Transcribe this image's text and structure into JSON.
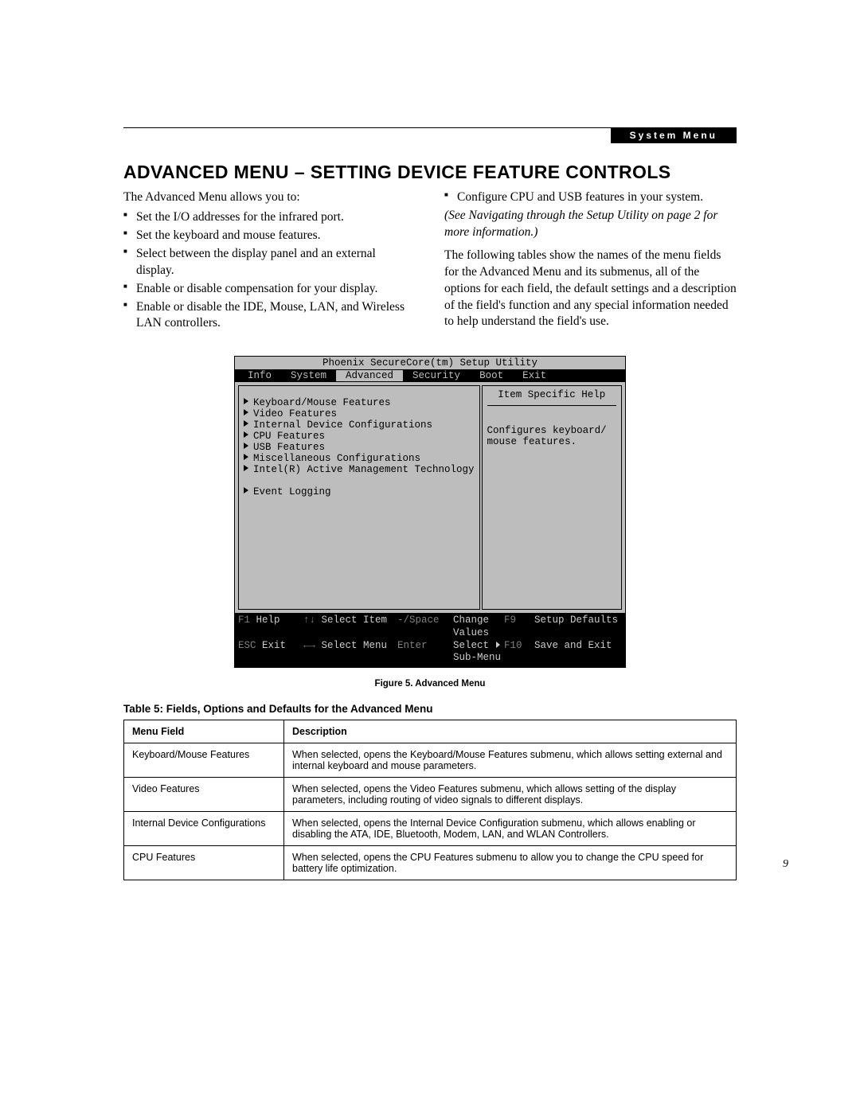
{
  "header_tag": "System Menu",
  "section_title": "ADVANCED MENU – SETTING DEVICE FEATURE CONTROLS",
  "intro": "The Advanced Menu allows you to:",
  "left_bullets": [
    "Set the I/O addresses for the infrared port.",
    "Set the keyboard and mouse features.",
    "Select between the display panel and an external display.",
    "Enable or disable compensation for your display.",
    "Enable or disable the IDE, Mouse, LAN, and Wireless LAN controllers."
  ],
  "right_bullet": "Configure CPU and USB features in your system.",
  "right_italic": "(See Navigating through the Setup Utility on page 2 for more information.)",
  "right_para": "The following tables show the names of the menu fields for the Advanced Menu and its submenus, all of the options for each field, the default settings and a description of the field's function and any special information needed to help understand the field's use.",
  "bios": {
    "title": "Phoenix SecureCore(tm) Setup Utility",
    "tabs": [
      "Info",
      "System",
      "Advanced",
      "Security",
      "Boot",
      "Exit"
    ],
    "active_tab": "Advanced",
    "items": [
      "Keyboard/Mouse Features",
      "Video Features",
      "Internal Device Configurations",
      "CPU Features",
      "USB Features",
      "Miscellaneous Configurations",
      "Intel(R) Active Management Technology",
      "",
      "Event Logging"
    ],
    "help_title": "Item Specific Help",
    "help_text": "Configures keyboard/ mouse features.",
    "footer": {
      "r1": {
        "k1": "F1",
        "v1": "Help",
        "k2": "↑↓",
        "v2": "Select Item",
        "k3": "-/Space",
        "v3": "Change Values",
        "k4": "F9",
        "v4": "Setup Defaults"
      },
      "r2": {
        "k1": "ESC",
        "v1": "Exit",
        "k2": "←→",
        "v2": "Select Menu",
        "k3": "Enter",
        "v3_pre": "Select ",
        "v3_post": " Sub-Menu",
        "k4": "F10",
        "v4": "Save and Exit"
      }
    }
  },
  "figure_caption": "Figure 5.  Advanced Menu",
  "table_caption": "Table 5: Fields, Options and Defaults for the Advanced Menu",
  "table": {
    "headers": [
      "Menu Field",
      "Description"
    ],
    "rows": [
      [
        "Keyboard/Mouse Features",
        "When selected, opens the Keyboard/Mouse Features submenu, which allows setting external and internal keyboard and mouse parameters."
      ],
      [
        "Video Features",
        "When selected, opens the Video Features submenu, which allows setting of the display parameters, including routing of video signals to different displays."
      ],
      [
        "Internal Device Configurations",
        "When selected, opens the Internal Device Configuration submenu, which allows enabling or disabling the ATA, IDE, Bluetooth, Modem, LAN, and WLAN Controllers."
      ],
      [
        "CPU Features",
        "When selected, opens the CPU Features submenu to allow you to change the CPU speed for battery life optimization."
      ]
    ]
  },
  "page_number": "9"
}
